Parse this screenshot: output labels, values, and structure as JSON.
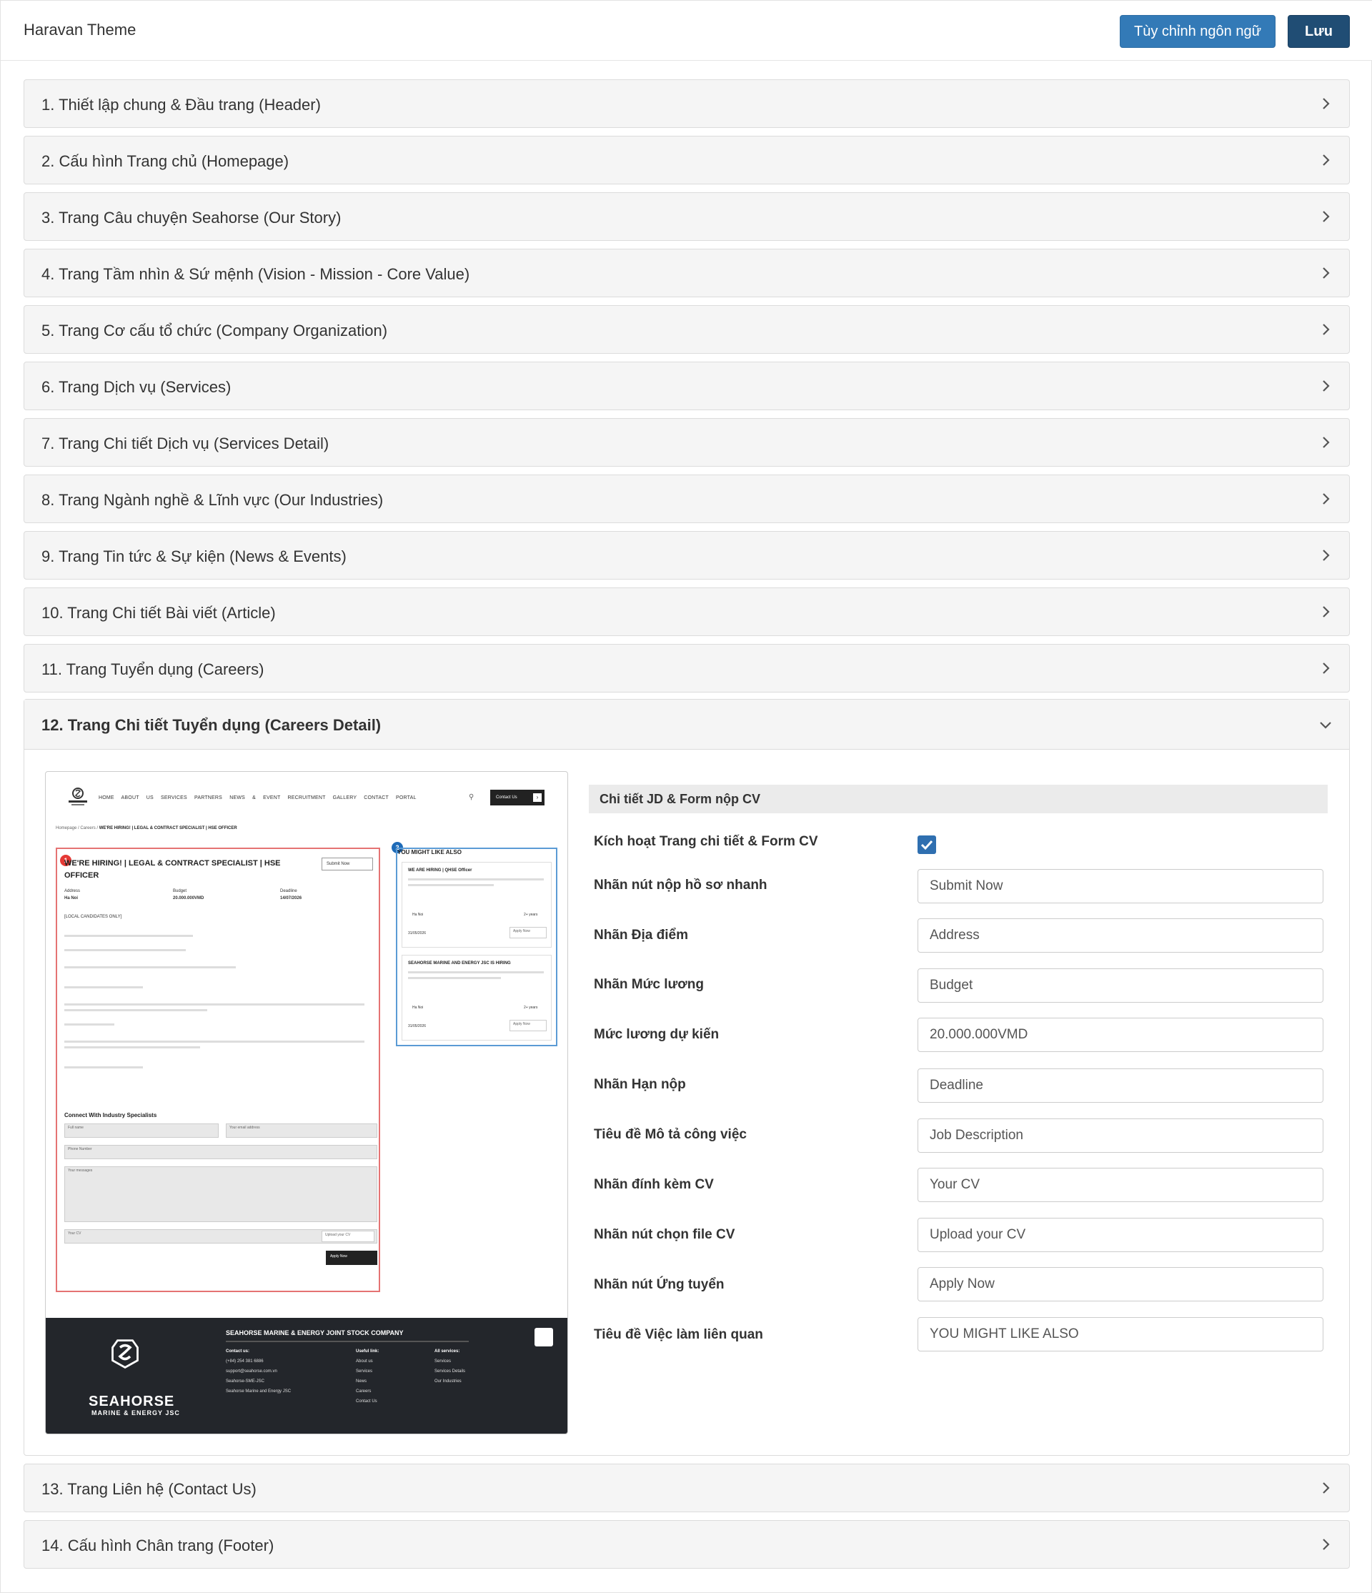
{
  "header": {
    "app_title": "Haravan Theme",
    "lang_button": "Tùy chỉnh ngôn ngữ",
    "save_button": "Lưu"
  },
  "sections": [
    {
      "label": "1. Thiết lập chung & Đầu trang (Header)",
      "expanded": false
    },
    {
      "label": "2. Cấu hình Trang chủ (Homepage)",
      "expanded": false
    },
    {
      "label": "3. Trang Câu chuyện Seahorse (Our Story)",
      "expanded": false
    },
    {
      "label": "4. Trang Tầm nhìn & Sứ mệnh (Vision - Mission - Core Value)",
      "expanded": false
    },
    {
      "label": "5. Trang Cơ cấu tổ chức (Company Organization)",
      "expanded": false
    },
    {
      "label": "6. Trang Dịch vụ (Services)",
      "expanded": false
    },
    {
      "label": "7. Trang Chi tiết Dịch vụ (Services Detail)",
      "expanded": false
    },
    {
      "label": "8. Trang Ngành nghề & Lĩnh vực (Our Industries)",
      "expanded": false
    },
    {
      "label": "9. Trang Tin tức & Sự kiện (News & Events)",
      "expanded": false
    },
    {
      "label": "10. Trang Chi tiết Bài viết (Article)",
      "expanded": false
    },
    {
      "label": "11. Trang Tuyển dụng (Careers)",
      "expanded": false
    },
    {
      "label": "12. Trang Chi tiết Tuyển dụng (Careers Detail)",
      "expanded": true
    },
    {
      "label": "13. Trang Liên hệ (Contact Us)",
      "expanded": false
    },
    {
      "label": "14. Cấu hình Chân trang (Footer)",
      "expanded": false
    }
  ],
  "preview": {
    "menu": "HOME ABOUT US SERVICES PARTNERS NEWS & EVENT RECRUITMENT GALLERY CONTACT PORTAL",
    "contact_button": "Contact Us",
    "breadcrumb_prefix": "Homepage / Careers /",
    "breadcrumb_current": "WE'RE HIRING! | LEGAL & CONTRACT SPECIALIST | HSE OFFICER",
    "badge_1": "1",
    "badge_2": "2",
    "job_title": "WE'RE HIRING! | LEGAL & CONTRACT SPECIALIST | HSE OFFICER",
    "submit_button": "Submit Now",
    "address_label": "Address",
    "address_value": "Ha Noi",
    "budget_label": "Budget",
    "budget_value": "20.000.000VMD",
    "deadline_label": "Deadline",
    "deadline_value": "14/07/2026",
    "local_note": "[LOCAL CANDIDATES ONLY]",
    "connect_heading": "Connect With Industry Specialists",
    "full_name": "Full name",
    "email": "Your email address",
    "phone": "Phone Number",
    "messages": "Your messages",
    "your_cv": "Your CV",
    "upload_cv": "Upload your CV",
    "apply_now": "Apply Now",
    "side_title": "YOU MIGHT LIKE ALSO",
    "card1_title": "WE ARE HIRING | QHSE Officer",
    "card2_title": "SEAHORSE MARINE AND ENERGY JSC IS HIRING",
    "card_location": "Ha Noi",
    "card_exp": "2+ years",
    "card_date": "31/05/2026",
    "footer_company": "SEAHORSE MARINE & ENERGY JOINT STOCK COMPANY",
    "footer_brand": "SEAHORSE",
    "footer_brand_sub": "MARINE & ENERGY JSC",
    "footer_contact_head": "Contact us:",
    "footer_phone": "(+84) 254 381 6886",
    "footer_email": "support@seahorse.com.vn",
    "footer_fb1": "Seahorse-SME-JSC",
    "footer_fb2": "Seahorse Marine and Energy JSC",
    "footer_useful_head": "Useful link:",
    "footer_useful": [
      "About us",
      "Services",
      "News",
      "Careers",
      "Contact Us"
    ],
    "footer_services_head": "All services:",
    "footer_services": [
      "Services",
      "Services Details",
      "Our Industries"
    ]
  },
  "form": {
    "heading": "Chi tiết JD & Form nộp CV",
    "enable_label": "Kích hoạt Trang chi tiết & Form CV",
    "enable_checked": true,
    "fields": [
      {
        "label": "Nhãn nút nộp hồ sơ nhanh",
        "value": "Submit Now"
      },
      {
        "label": "Nhãn Địa điểm",
        "value": "Address"
      },
      {
        "label": "Nhãn Mức lương",
        "value": "Budget"
      },
      {
        "label": "Mức lương dự kiến",
        "value": "20.000.000VMD"
      },
      {
        "label": "Nhãn Hạn nộp",
        "value": "Deadline"
      },
      {
        "label": "Tiêu đề Mô tả công việc",
        "value": "Job Description"
      },
      {
        "label": "Nhãn đính kèm CV",
        "value": "Your CV"
      },
      {
        "label": "Nhãn nút chọn file CV",
        "value": "Upload your CV"
      },
      {
        "label": "Nhãn nút Ứng tuyển",
        "value": "Apply Now"
      },
      {
        "label": "Tiêu đề Việc làm liên quan",
        "value": "YOU MIGHT LIKE ALSO"
      }
    ]
  },
  "colors": {
    "primary": "#337ab7",
    "save": "#204d74",
    "panel_bg": "#f5f5f5",
    "badge_red": "#e53935",
    "badge_blue": "#1e6bb8"
  }
}
